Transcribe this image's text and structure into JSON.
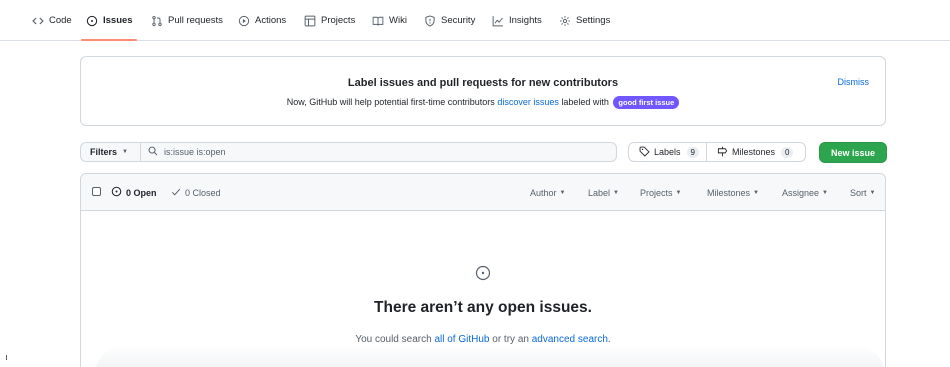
{
  "nav": {
    "tabs": [
      {
        "label": "Code",
        "icon": "code-icon"
      },
      {
        "label": "Issues",
        "icon": "issue-opened-icon",
        "selected": true
      },
      {
        "label": "Pull requests",
        "icon": "git-pull-request-icon"
      },
      {
        "label": "Actions",
        "icon": "play-icon"
      },
      {
        "label": "Projects",
        "icon": "table-icon"
      },
      {
        "label": "Wiki",
        "icon": "book-icon"
      },
      {
        "label": "Security",
        "icon": "shield-icon"
      },
      {
        "label": "Insights",
        "icon": "graph-icon"
      },
      {
        "label": "Settings",
        "icon": "gear-icon"
      }
    ]
  },
  "banner": {
    "title": "Label issues and pull requests for new contributors",
    "text_before": "Now, GitHub will help potential first-time contributors",
    "link": "discover issues",
    "text_after": "labeled with",
    "label": "good first issue",
    "dismiss": "Dismiss"
  },
  "toolbar": {
    "filters": "Filters",
    "search_value": "is:issue is:open",
    "labels": "Labels",
    "labels_count": "9",
    "milestones": "Milestones",
    "milestones_count": "0",
    "new_issue": "New issue"
  },
  "issues_header": {
    "open": "0 Open",
    "closed": "0 Closed",
    "menus": [
      "Author",
      "Label",
      "Projects",
      "Milestones",
      "Assignee",
      "Sort"
    ]
  },
  "blankslate": {
    "title": "There aren’t any open issues.",
    "text_before": "You could search",
    "link1": "all of GitHub",
    "text_mid": "or try an",
    "link2": "advanced search",
    "text_after": "."
  },
  "colors": {
    "accent_underline": "#fd8c73",
    "primary_button": "#2da44e",
    "link": "#0969da",
    "good_first_issue_label": "#7057ff"
  }
}
